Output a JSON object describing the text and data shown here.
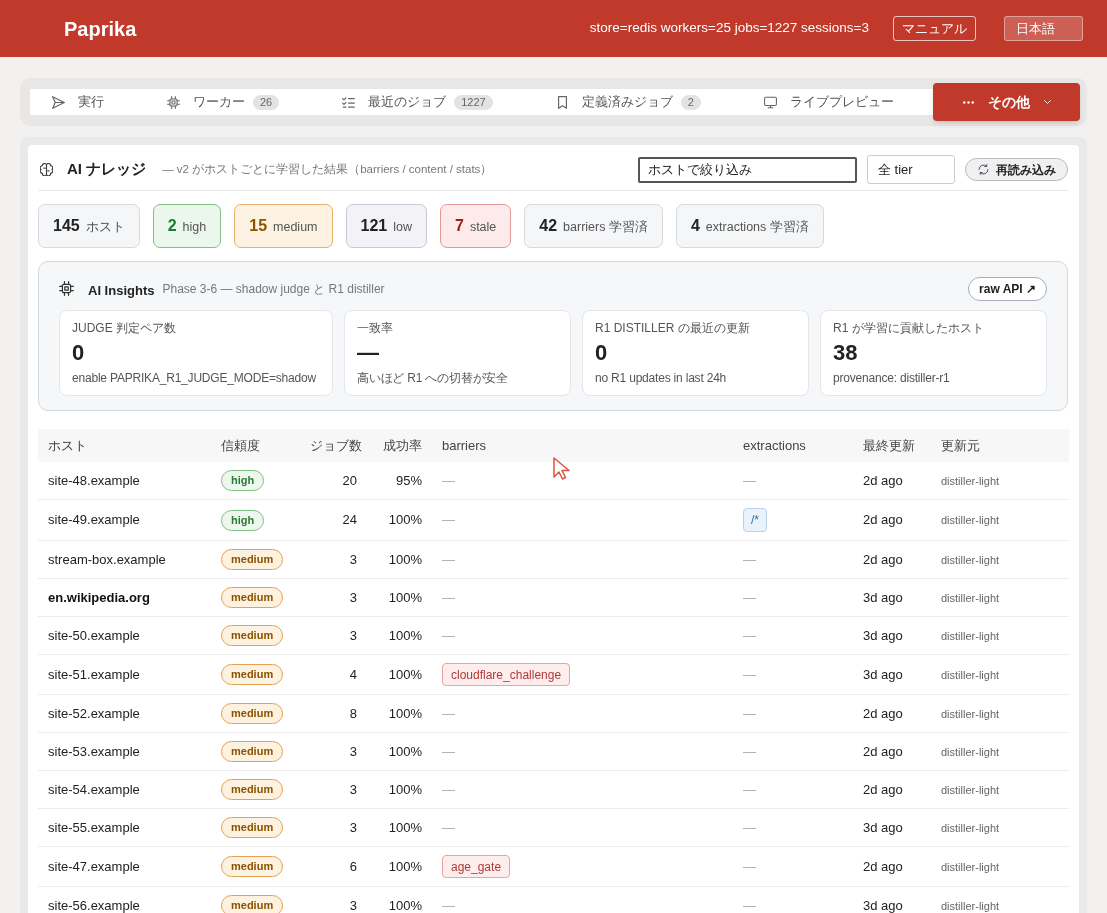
{
  "header": {
    "brand": "Paprika",
    "status": "store=redis workers=25 jobs=1227 sessions=3",
    "manual_button": "マニュアル",
    "language": "日本語"
  },
  "tabs": [
    {
      "label": "実行",
      "kind": "tab",
      "selected": false
    },
    {
      "label": "ワーカー",
      "count": "26",
      "kind": "tab",
      "selected": false
    },
    {
      "label": "最近のジョブ",
      "count": "1227",
      "kind": "tab",
      "selected": false
    },
    {
      "label": "定義済みジョブ",
      "count": "2",
      "kind": "tab",
      "selected": false
    },
    {
      "label": "ライブプレビュー",
      "kind": "tab",
      "selected": false
    },
    {
      "label": "その他",
      "kind": "menu",
      "selected": true
    }
  ],
  "knowledge": {
    "title": "AI ナレッジ",
    "subtitle": "— v2 がホストごとに学習した結果（barriers / content / stats）",
    "filter": {
      "placeholder": "ホストで絞り込み"
    },
    "tier_select": {
      "value": "全 tier"
    },
    "reload_button": "再読み込み"
  },
  "stats": [
    {
      "value": "145",
      "label": "ホスト",
      "kind": "neutral"
    },
    {
      "value": "2",
      "label": "high",
      "kind": "high"
    },
    {
      "value": "15",
      "label": "medium",
      "kind": "medium"
    },
    {
      "value": "121",
      "label": "low",
      "kind": "low"
    },
    {
      "value": "7",
      "label": "stale",
      "kind": "stale"
    },
    {
      "value": "42",
      "label": "barriers 学習済",
      "kind": "neutral"
    },
    {
      "value": "4",
      "label": "extractions 学習済",
      "kind": "neutral"
    }
  ],
  "insights": {
    "title": "AI Insights",
    "subtitle": "Phase 3-6 — shadow judge と R1 distiller",
    "api_link": "raw API ↗",
    "cards": [
      {
        "label": "JUDGE 判定ペア数",
        "value": "0",
        "note": "enable PAPRIKA_R1_JUDGE_MODE=shadow"
      },
      {
        "label": "一致率",
        "value": "—",
        "note": "高いほど R1 への切替が安全"
      },
      {
        "label": "R1 DISTILLER の最近の更新",
        "value": "0",
        "note": "no R1 updates in last 24h"
      },
      {
        "label": "R1 が学習に貢献したホスト",
        "value": "38",
        "note": "provenance: distiller-r1"
      }
    ]
  },
  "table": {
    "columns": [
      "ホスト",
      "信頼度",
      "ジョブ数",
      "成功率",
      "barriers",
      "extractions",
      "最終更新",
      "更新元"
    ],
    "rows": [
      {
        "host": "site-48.example",
        "emphasized": false,
        "confidence": {
          "text": "high",
          "kind": "high"
        },
        "jobs": "20",
        "success_rate": "95%",
        "barriers": {
          "kind": "none",
          "text": "—"
        },
        "extractions": {
          "kind": "none",
          "text": "—"
        },
        "updated": "2d ago",
        "source": "distiller-light"
      },
      {
        "host": "site-49.example",
        "emphasized": false,
        "confidence": {
          "text": "high",
          "kind": "high"
        },
        "jobs": "24",
        "success_rate": "100%",
        "barriers": {
          "kind": "none",
          "text": "—"
        },
        "extractions": {
          "kind": "tag",
          "text": "/*"
        },
        "updated": "2d ago",
        "source": "distiller-light"
      },
      {
        "host": "stream-box.example",
        "emphasized": false,
        "confidence": {
          "text": "medium",
          "kind": "medium"
        },
        "jobs": "3",
        "success_rate": "100%",
        "barriers": {
          "kind": "none",
          "text": "—"
        },
        "extractions": {
          "kind": "none",
          "text": "—"
        },
        "updated": "2d ago",
        "source": "distiller-light"
      },
      {
        "host": "en.wikipedia.org",
        "emphasized": true,
        "confidence": {
          "text": "medium",
          "kind": "medium"
        },
        "jobs": "3",
        "success_rate": "100%",
        "barriers": {
          "kind": "none",
          "text": "—"
        },
        "extractions": {
          "kind": "none",
          "text": "—"
        },
        "updated": "3d ago",
        "source": "distiller-light"
      },
      {
        "host": "site-50.example",
        "emphasized": false,
        "confidence": {
          "text": "medium",
          "kind": "medium"
        },
        "jobs": "3",
        "success_rate": "100%",
        "barriers": {
          "kind": "none",
          "text": "—"
        },
        "extractions": {
          "kind": "none",
          "text": "—"
        },
        "updated": "3d ago",
        "source": "distiller-light"
      },
      {
        "host": "site-51.example",
        "emphasized": false,
        "confidence": {
          "text": "medium",
          "kind": "medium"
        },
        "jobs": "4",
        "success_rate": "100%",
        "barriers": {
          "kind": "tag",
          "text": "cloudflare_challenge"
        },
        "extractions": {
          "kind": "none",
          "text": "—"
        },
        "updated": "3d ago",
        "source": "distiller-light"
      },
      {
        "host": "site-52.example",
        "emphasized": false,
        "confidence": {
          "text": "medium",
          "kind": "medium"
        },
        "jobs": "8",
        "success_rate": "100%",
        "barriers": {
          "kind": "none",
          "text": "—"
        },
        "extractions": {
          "kind": "none",
          "text": "—"
        },
        "updated": "2d ago",
        "source": "distiller-light"
      },
      {
        "host": "site-53.example",
        "emphasized": false,
        "confidence": {
          "text": "medium",
          "kind": "medium"
        },
        "jobs": "3",
        "success_rate": "100%",
        "barriers": {
          "kind": "none",
          "text": "—"
        },
        "extractions": {
          "kind": "none",
          "text": "—"
        },
        "updated": "2d ago",
        "source": "distiller-light"
      },
      {
        "host": "site-54.example",
        "emphasized": false,
        "confidence": {
          "text": "medium",
          "kind": "medium"
        },
        "jobs": "3",
        "success_rate": "100%",
        "barriers": {
          "kind": "none",
          "text": "—"
        },
        "extractions": {
          "kind": "none",
          "text": "—"
        },
        "updated": "2d ago",
        "source": "distiller-light"
      },
      {
        "host": "site-55.example",
        "emphasized": false,
        "confidence": {
          "text": "medium",
          "kind": "medium"
        },
        "jobs": "3",
        "success_rate": "100%",
        "barriers": {
          "kind": "none",
          "text": "—"
        },
        "extractions": {
          "kind": "none",
          "text": "—"
        },
        "updated": "3d ago",
        "source": "distiller-light"
      },
      {
        "host": "site-47.example",
        "emphasized": false,
        "confidence": {
          "text": "medium",
          "kind": "medium"
        },
        "jobs": "6",
        "success_rate": "100%",
        "barriers": {
          "kind": "tag",
          "text": "age_gate"
        },
        "extractions": {
          "kind": "none",
          "text": "—"
        },
        "updated": "2d ago",
        "source": "distiller-light"
      },
      {
        "host": "site-56.example",
        "emphasized": false,
        "confidence": {
          "text": "medium",
          "kind": "medium"
        },
        "jobs": "3",
        "success_rate": "100%",
        "barriers": {
          "kind": "none",
          "text": "—"
        },
        "extractions": {
          "kind": "none",
          "text": "—"
        },
        "updated": "3d ago",
        "source": "distiller-light"
      }
    ]
  }
}
